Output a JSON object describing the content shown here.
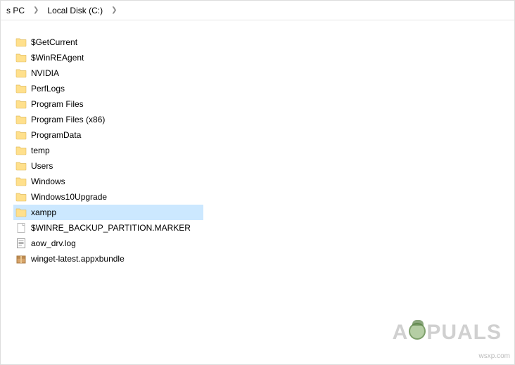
{
  "breadcrumb": {
    "parent": "s PC",
    "current": "Local Disk (C:)"
  },
  "items": [
    {
      "name": "$GetCurrent",
      "kind": "folder",
      "selected": false
    },
    {
      "name": "$WinREAgent",
      "kind": "folder",
      "selected": false
    },
    {
      "name": "NVIDIA",
      "kind": "folder",
      "selected": false
    },
    {
      "name": "PerfLogs",
      "kind": "folder",
      "selected": false
    },
    {
      "name": "Program Files",
      "kind": "folder",
      "selected": false
    },
    {
      "name": "Program Files (x86)",
      "kind": "folder",
      "selected": false
    },
    {
      "name": "ProgramData",
      "kind": "folder",
      "selected": false
    },
    {
      "name": "temp",
      "kind": "folder",
      "selected": false
    },
    {
      "name": "Users",
      "kind": "folder",
      "selected": false
    },
    {
      "name": "Windows",
      "kind": "folder",
      "selected": false
    },
    {
      "name": "Windows10Upgrade",
      "kind": "folder",
      "selected": false
    },
    {
      "name": "xampp",
      "kind": "folder",
      "selected": true
    },
    {
      "name": "$WINRE_BACKUP_PARTITION.MARKER",
      "kind": "file",
      "selected": false
    },
    {
      "name": "aow_drv.log",
      "kind": "text",
      "selected": false
    },
    {
      "name": "winget-latest.appxbundle",
      "kind": "bundle",
      "selected": false
    }
  ],
  "watermark": {
    "left": "A",
    "right": "PUALS"
  },
  "site": "wsxp.com"
}
